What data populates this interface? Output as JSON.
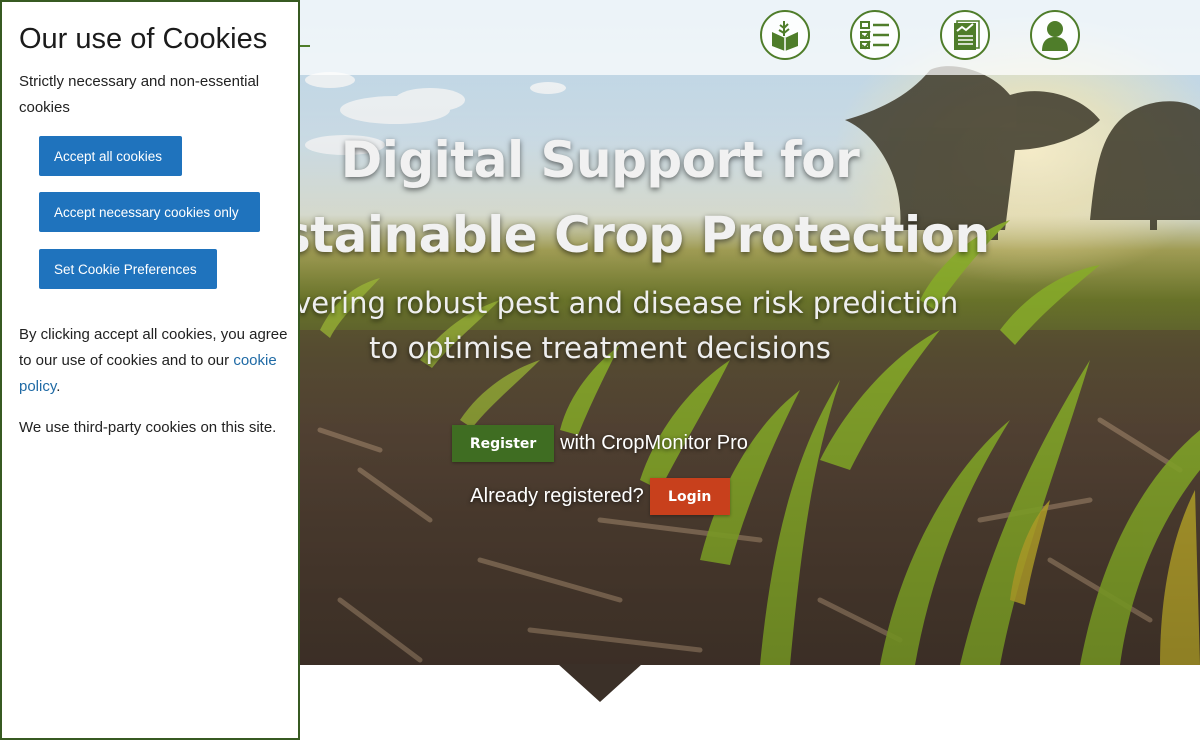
{
  "hero": {
    "title_line1": "Digital Support for",
    "title_line2": "Sustainable Crop Protection",
    "subtitle_line1": "delivering robust pest and disease risk prediction",
    "subtitle_line2": "to optimise treatment decisions",
    "register_label": "Register",
    "register_suffix": "with CropMonitor Pro",
    "already_registered": "Already registered?",
    "login_label": "Login"
  },
  "nav": {
    "icons": [
      "crop-book-icon",
      "checklist-icon",
      "report-chart-icon",
      "user-profile-icon"
    ]
  },
  "cookie_banner": {
    "title": "Our use of Cookies",
    "subtitle": "Strictly necessary and non-essential cookies",
    "accept_all": "Accept all cookies",
    "accept_necessary": "Accept necessary cookies only",
    "set_preferences": "Set Cookie Preferences",
    "consent_text": "By clicking accept all cookies, you agree to our use of cookies and to our ",
    "policy_link": "cookie policy",
    "consent_suffix": ".",
    "third_party_text": "We use third-party cookies on this site."
  },
  "colors": {
    "brand_green": "#4f7d2a",
    "register_green": "#3f6d22",
    "login_red": "#c8401c",
    "cookie_button_blue": "#1f73bd",
    "panel_border": "#375a22"
  }
}
